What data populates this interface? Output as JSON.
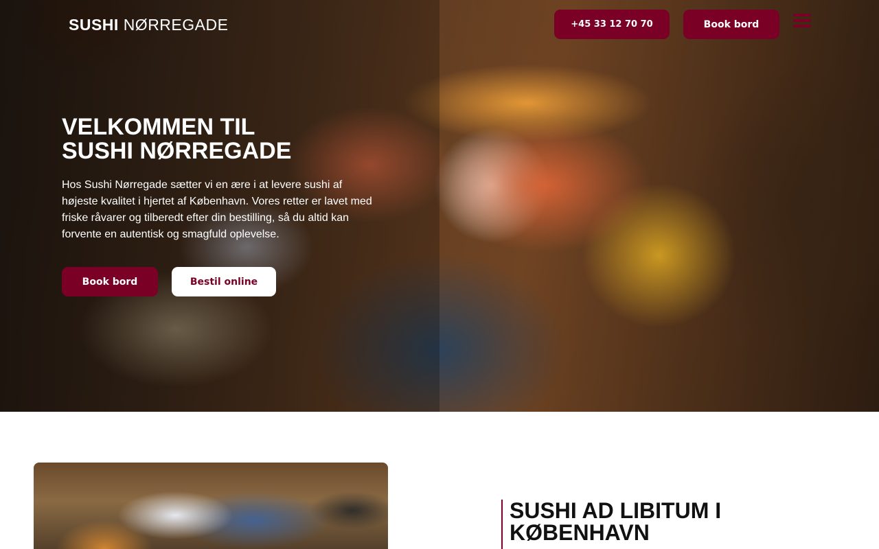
{
  "header": {
    "logo": {
      "bold": "SUSHI",
      "light": "NØRREGADE"
    },
    "phone_label": "+45 33 12 70 70",
    "book_label": "Book bord",
    "menu_icon": "hamburger-menu-icon"
  },
  "hero": {
    "title_line1": "VELKOMMEN TIL",
    "title_line2": "SUSHI NØRREGADE",
    "text": "Hos Sushi Nørregade sætter vi en ære i at levere sushi af højeste kvalitet i hjertet af København. Vores retter er lavet med friske råvarer og tilberedt efter din bestilling, så du altid kan forvente en autentisk og smagfuld oplevelse.",
    "book_label": "Book bord",
    "order_label": "Bestil online"
  },
  "section": {
    "title_line1": "SUSHI AD LIBITUM I",
    "title_line2": "KØBENHAVN"
  },
  "colors": {
    "accent": "#7a0026",
    "white": "#ffffff"
  }
}
